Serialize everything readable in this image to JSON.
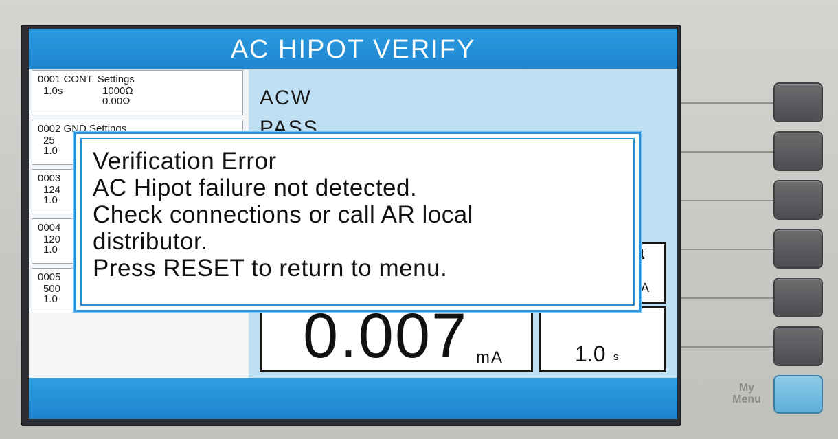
{
  "screen": {
    "title": "AC HIPOT VERIFY",
    "test_list": [
      {
        "head": "0001 CONT. Settings",
        "left": "1.0s",
        "right1": "1000Ω",
        "right2": "0.00Ω",
        "left2": ""
      },
      {
        "head": "0002 GND Settings",
        "left": "25",
        "right1": "",
        "right2": "",
        "left2": "1.0"
      },
      {
        "head": "0003",
        "left": "124",
        "right1": "",
        "right2": "",
        "left2": "1.0"
      },
      {
        "head": "0004",
        "left": "120",
        "right1": "",
        "right2": "",
        "left2": "1.0"
      },
      {
        "head": "0005",
        "left": "500",
        "right1": "",
        "right2": "",
        "left2": "1.0"
      }
    ],
    "mode": "ACW",
    "result": "PASS",
    "meter_current": {
      "value": "0.007",
      "unit": "mA"
    },
    "meter_side_top": {
      "label": "nt",
      "unit": "nA"
    },
    "meter_time": {
      "value": "1.0",
      "unit": "s"
    }
  },
  "dialog": {
    "lines": [
      "Verification Error",
      "AC Hipot failure not detected.",
      "Check connections or call AR local",
      "distributor.",
      "Press RESET to return to menu."
    ]
  },
  "panel": {
    "soft_keys": [
      "soft-key-1",
      "soft-key-2",
      "soft-key-3",
      "soft-key-4",
      "soft-key-5",
      "soft-key-6"
    ],
    "my_menu_label_line1": "My",
    "my_menu_label_line2": "Menu",
    "accent_blue": "#1f86cf",
    "my_menu_color": "#5fb0d9"
  }
}
